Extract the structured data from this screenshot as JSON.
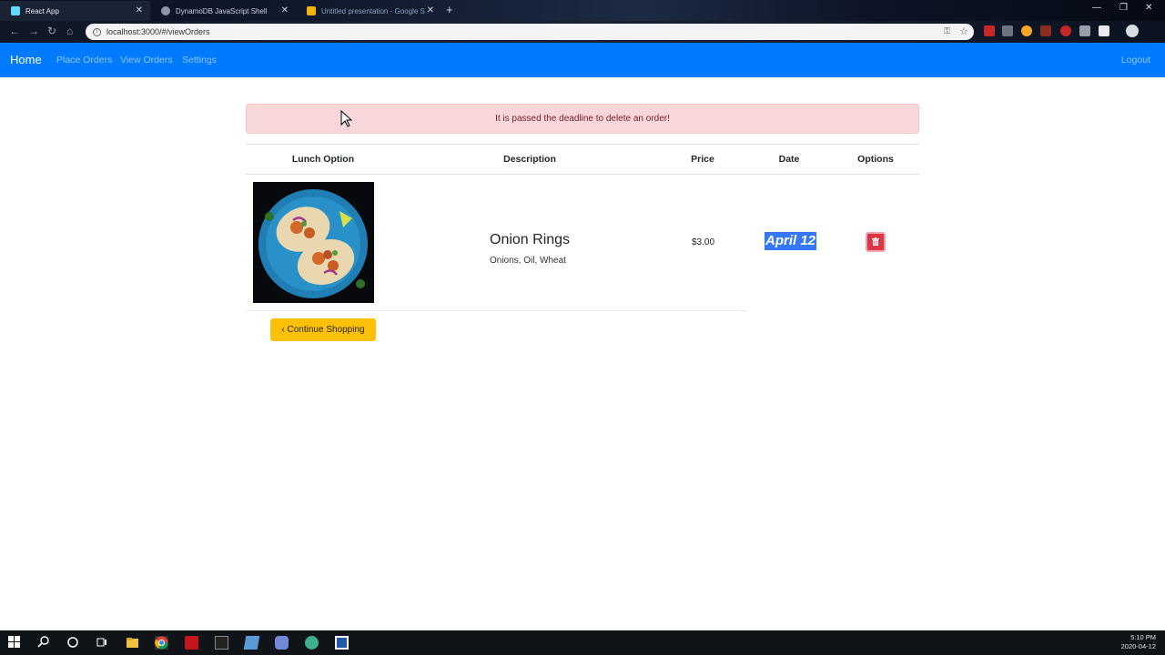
{
  "browser": {
    "tabs": [
      {
        "title": "React App",
        "active": true
      },
      {
        "title": "DynamoDB JavaScript Shell",
        "active": false
      },
      {
        "title": "Untitled presentation - Google S",
        "active": false
      }
    ],
    "url": "localhost:3000/#/viewOrders"
  },
  "navbar": {
    "brand": "Home",
    "links": [
      "Place Orders",
      "View Orders",
      "Settings"
    ],
    "logout": "Logout",
    "color": "#007bff"
  },
  "alert": {
    "message": "It is passed the deadline to delete an order!"
  },
  "table": {
    "headers": [
      "Lunch Option",
      "Description",
      "Price",
      "Date",
      "Options"
    ],
    "rows": [
      {
        "image_icon": "taco-plate-image",
        "name": "Onion Rings",
        "ingredients": "Onions, Oil, Wheat",
        "price": "$3.00",
        "date": "April 12",
        "option_icon": "trash-icon"
      }
    ]
  },
  "actions": {
    "continue_label": "‹ Continue Shopping"
  },
  "taskbar": {
    "time": "5:10 PM",
    "date": "2020-04-12"
  }
}
